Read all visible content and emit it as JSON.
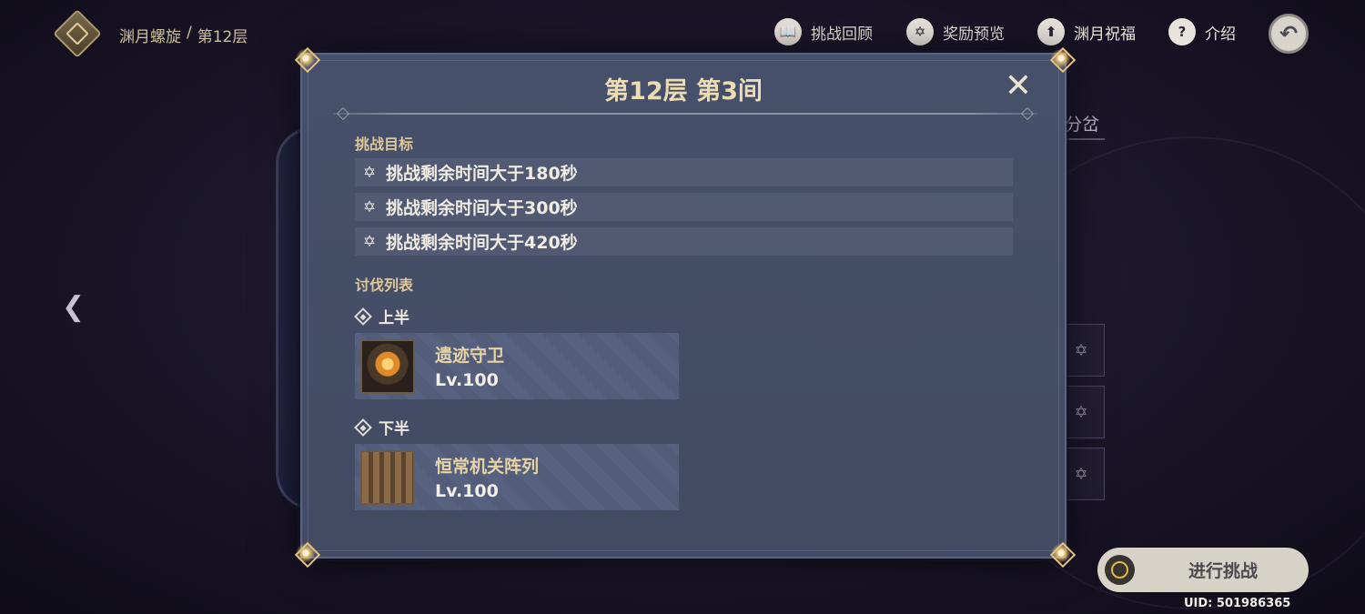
{
  "breadcrumb": {
    "part1": "渊月螺旋",
    "separator": "/",
    "part2": "第12层"
  },
  "topnav": [
    {
      "icon": "book-icon",
      "glyph": "📖",
      "label": "挑战回顾"
    },
    {
      "icon": "star-icon",
      "glyph": "✡",
      "label": "奖励预览"
    },
    {
      "icon": "upgrade-icon",
      "glyph": "⬆",
      "label": "渊月祝福"
    },
    {
      "icon": "help-icon",
      "glyph": "?",
      "label": "介绍"
    }
  ],
  "background": {
    "side_tab_label": "分岔"
  },
  "modal": {
    "title": "第12层 第3间",
    "objectives_label": "挑战目标",
    "objectives": [
      "挑战剩余时间大于180秒",
      "挑战剩余时间大于300秒",
      "挑战剩余时间大于420秒"
    ],
    "enemy_list_label": "讨伐列表",
    "first_half": {
      "label": "上半",
      "enemy": {
        "name": "遗迹守卫",
        "level": "Lv.100"
      }
    },
    "second_half": {
      "label": "下半",
      "enemy": {
        "name": "恒常机关阵列",
        "level": "Lv.100"
      }
    }
  },
  "start_button_label": "进行挑战",
  "uid": "UID: 501986365",
  "colors": {
    "accent_gold": "#ecdcb3",
    "panel": "#47506a"
  }
}
